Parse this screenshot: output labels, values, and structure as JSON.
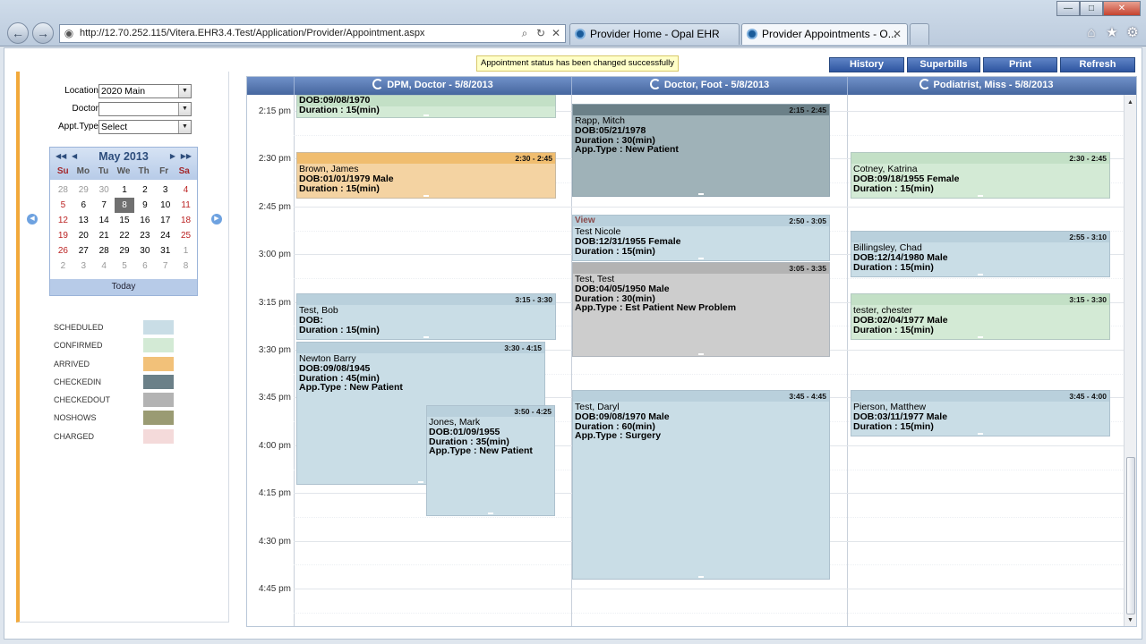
{
  "browser": {
    "url": "http://12.70.252.115/Vitera.EHR3.4.Test/Application/Provider/Appointment.aspx",
    "tabs": [
      {
        "label": "Provider Home - Opal EHR"
      },
      {
        "label": "Provider Appointments - O..."
      }
    ],
    "window_buttons": {
      "minimize": "—",
      "maximize": "□",
      "close": "✕"
    },
    "nav": {
      "back": "←",
      "forward": "→"
    }
  },
  "filters": {
    "location_label": "Location",
    "location_value": "2020 Main",
    "doctor_label": "Doctor",
    "doctor_value": "",
    "appt_type_label": "Appt.Type",
    "appt_type_value": "Select"
  },
  "calendar": {
    "title": "May 2013",
    "dows": [
      "Su",
      "Mo",
      "Tu",
      "We",
      "Th",
      "Fr",
      "Sa"
    ],
    "weeks": [
      [
        "28",
        "29",
        "30",
        "1",
        "2",
        "3",
        "4"
      ],
      [
        "5",
        "6",
        "7",
        "8",
        "9",
        "10",
        "11"
      ],
      [
        "12",
        "13",
        "14",
        "15",
        "16",
        "17",
        "18"
      ],
      [
        "19",
        "20",
        "21",
        "22",
        "23",
        "24",
        "25"
      ],
      [
        "26",
        "27",
        "28",
        "29",
        "30",
        "31",
        "1"
      ],
      [
        "2",
        "3",
        "4",
        "5",
        "6",
        "7",
        "8"
      ]
    ],
    "selected": "8",
    "today_label": "Today"
  },
  "legend": [
    {
      "label": "SCHEDULED",
      "color": "#c9dde6"
    },
    {
      "label": "CONFIRMED",
      "color": "#d3ead5"
    },
    {
      "label": "ARRIVED",
      "color": "#f2c179"
    },
    {
      "label": "CHECKEDIN",
      "color": "#6b8088"
    },
    {
      "label": "CHECKEDOUT",
      "color": "#b3b3b3"
    },
    {
      "label": "NOSHOWS",
      "color": "#9a9b73"
    },
    {
      "label": "CHARGED",
      "color": "#f4dada"
    }
  ],
  "toolbar": {
    "notice": "Appointment status has been changed successfully",
    "history": "History",
    "superbills": "Superbills",
    "print": "Print",
    "refresh": "Refresh"
  },
  "schedule": {
    "columns": [
      {
        "label": "DPM, Doctor - 5/8/2013"
      },
      {
        "label": "Doctor, Foot - 5/8/2013"
      },
      {
        "label": "Podiatrist, Miss - 5/8/2013"
      }
    ],
    "times": [
      "2:15 pm",
      "2:30 pm",
      "2:45 pm",
      "3:00 pm",
      "3:15 pm",
      "3:30 pm",
      "3:45 pm",
      "4:00 pm",
      "4:15 pm",
      "4:30 pm",
      "4:45 pm"
    ],
    "appointments": [
      {
        "id": "a0",
        "status": "confirmed",
        "time": "",
        "name": "",
        "dob": "DOB:09/08/1970",
        "duration": "Duration : 15(min)",
        "type": ""
      },
      {
        "id": "a1",
        "status": "checkedin",
        "time": "2:15 - 2:45",
        "name": "Rapp, Mitch",
        "dob": "DOB:05/21/1978",
        "duration": "Duration : 30(min)",
        "type": "App.Type : New Patient"
      },
      {
        "id": "a2",
        "status": "arrived",
        "time": "2:30 - 2:45",
        "name": "Brown, James",
        "dob": "DOB:01/01/1979 Male",
        "duration": "Duration : 15(min)",
        "type": ""
      },
      {
        "id": "a3",
        "status": "confirmed",
        "time": "2:30 - 2:45",
        "name": "Cotney, Katrina",
        "dob": "DOB:09/18/1955 Female",
        "duration": "Duration : 15(min)",
        "type": ""
      },
      {
        "id": "a4",
        "status": "scheduled",
        "time": "2:50 - 3:05",
        "name": "Test Nicole",
        "dob": "DOB:12/31/1955 Female",
        "duration": "Duration : 15(min)",
        "type": "",
        "view": "View"
      },
      {
        "id": "a5",
        "status": "scheduled",
        "time": "2:55 - 3:10",
        "name": "Billingsley, Chad",
        "dob": "DOB:12/14/1980 Male",
        "duration": "Duration : 15(min)",
        "type": ""
      },
      {
        "id": "a6",
        "status": "checkedout",
        "time": "3:05 - 3:35",
        "name": "Test, Test",
        "dob": "DOB:04/05/1950 Male",
        "duration": "Duration : 30(min)",
        "type": "App.Type : Est Patient New Problem"
      },
      {
        "id": "a7",
        "status": "scheduled",
        "time": "3:15 - 3:30",
        "name": "Test, Bob",
        "dob": "DOB:",
        "duration": "Duration : 15(min)",
        "type": ""
      },
      {
        "id": "a8",
        "status": "confirmed",
        "time": "3:15 - 3:30",
        "name": "tester, chester",
        "dob": "DOB:02/04/1977 Male",
        "duration": "Duration : 15(min)",
        "type": ""
      },
      {
        "id": "a9",
        "status": "scheduled",
        "time": "3:30 - 4:15",
        "name": "Newton Barry",
        "dob": "DOB:09/08/1945",
        "duration": "Duration : 45(min)",
        "type": "App.Type : New Patient"
      },
      {
        "id": "a10",
        "status": "scheduled",
        "time": "3:45 - 4:45",
        "name": "Test, Daryl",
        "dob": "DOB:09/08/1970 Male",
        "duration": "Duration : 60(min)",
        "type": "App.Type : Surgery"
      },
      {
        "id": "a11",
        "status": "scheduled",
        "time": "3:45 - 4:00",
        "name": "Pierson, Matthew",
        "dob": "DOB:03/11/1977 Male",
        "duration": "Duration : 15(min)",
        "type": ""
      },
      {
        "id": "a12",
        "status": "scheduled",
        "time": "3:50 - 4:25",
        "name": "Jones, Mark",
        "dob": "DOB:01/09/1955",
        "duration": "Duration : 35(min)",
        "type": "App.Type : New Patient"
      }
    ]
  }
}
